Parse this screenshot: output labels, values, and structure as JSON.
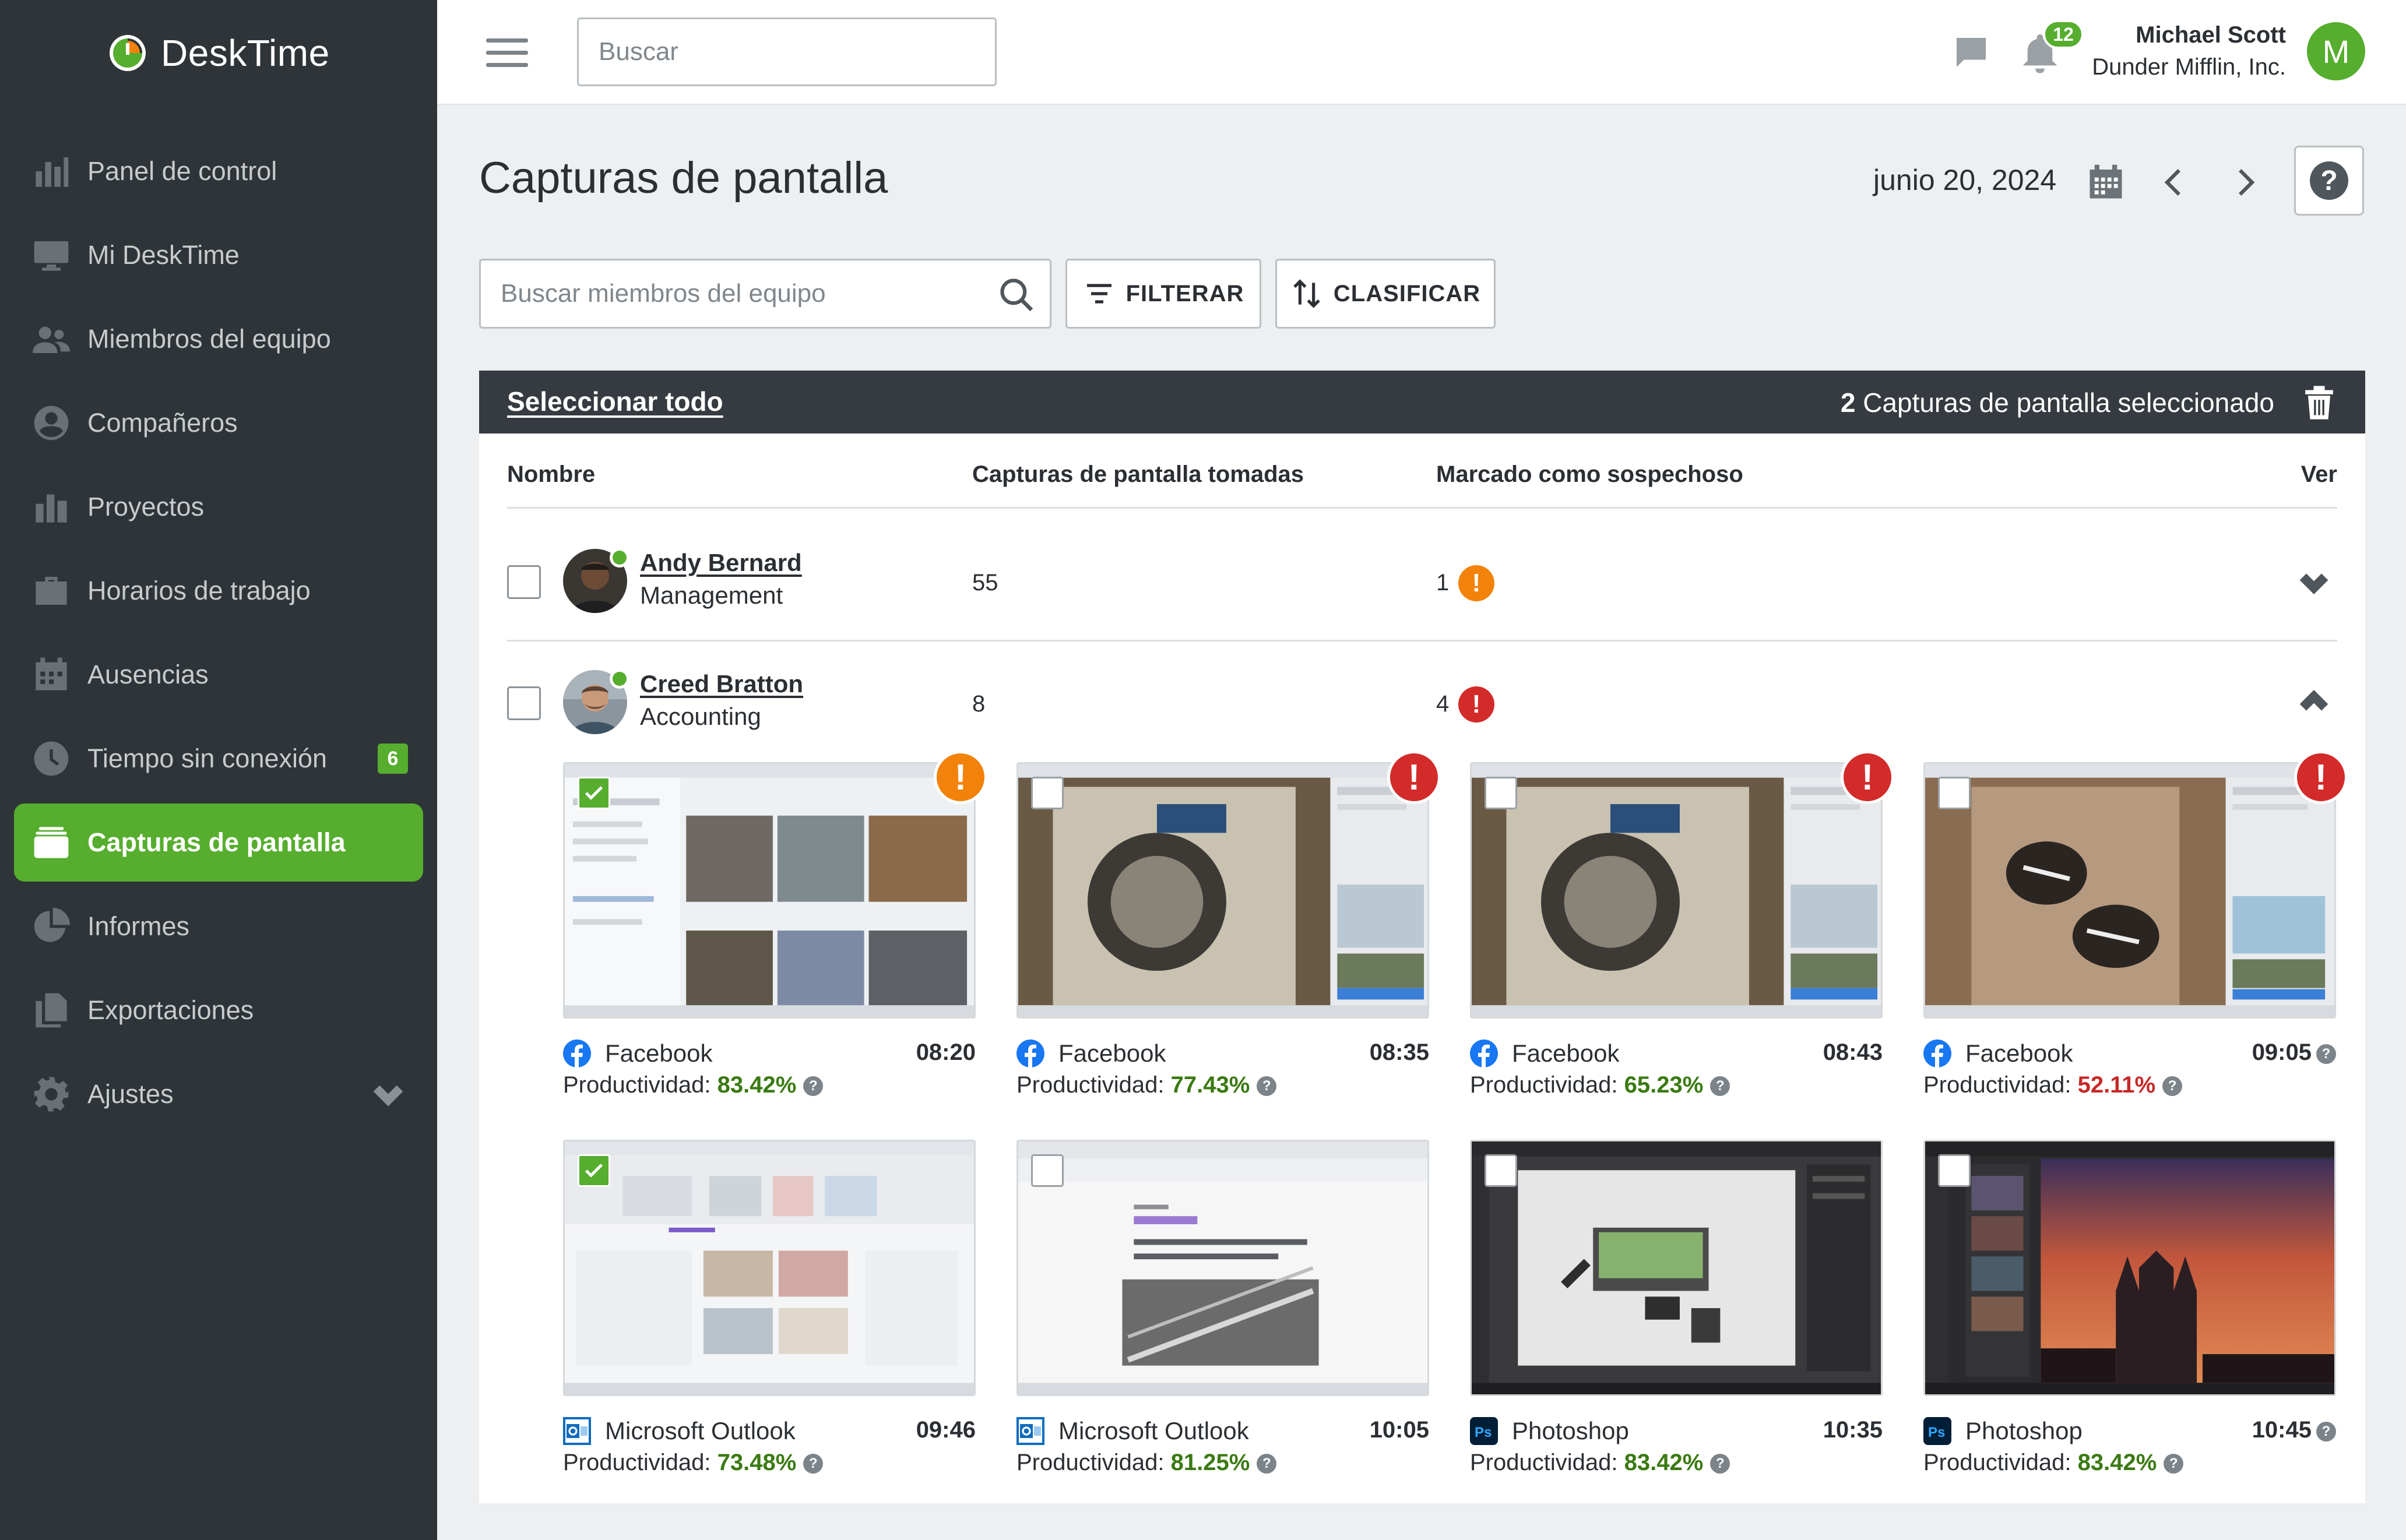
{
  "app": {
    "name": "DeskTime"
  },
  "sidebar": {
    "items": [
      {
        "label": "Panel de control",
        "icon": "bar-chart-icon"
      },
      {
        "label": "Mi DeskTime",
        "icon": "monitor-icon"
      },
      {
        "label": "Miembros del equipo",
        "icon": "team-icon"
      },
      {
        "label": "Compañeros",
        "icon": "user-circle-icon"
      },
      {
        "label": "Proyectos",
        "icon": "projects-chart-icon"
      },
      {
        "label": "Horarios de trabajo",
        "icon": "briefcase-icon"
      },
      {
        "label": "Ausencias",
        "icon": "calendar-icon"
      },
      {
        "label": "Tiempo sin conexión",
        "icon": "clock-icon",
        "badge": "6"
      },
      {
        "label": "Capturas de pantalla",
        "icon": "screenshots-icon",
        "active": true
      },
      {
        "label": "Informes",
        "icon": "pie-chart-icon"
      },
      {
        "label": "Exportaciones",
        "icon": "export-icon"
      },
      {
        "label": "Ajustes",
        "icon": "gear-icon",
        "expandable": true
      }
    ]
  },
  "topbar": {
    "search_placeholder": "Buscar",
    "notifications_count": "12",
    "user_name": "Michael Scott",
    "user_company": "Dunder Mifflin, Inc.",
    "user_initial": "M"
  },
  "page": {
    "title": "Capturas de pantalla",
    "date": "junio 20, 2024"
  },
  "toolbar": {
    "member_search_placeholder": "Buscar miembros del equipo",
    "filter_label": "FILTERAR",
    "sort_label": "CLASIFICAR"
  },
  "table": {
    "select_all": "Seleccionar todo",
    "selected_count": "2",
    "selected_text": "Capturas de pantalla seleccionado",
    "columns": {
      "name": "Nombre",
      "taken": "Capturas de pantalla tomadas",
      "suspicious": "Marcado como sospechoso",
      "view": "Ver"
    },
    "rows": [
      {
        "name": "Andy Bernard",
        "department": "Management",
        "taken": "55",
        "suspicious": "1",
        "flag_color": "#f2820a",
        "expanded": false
      },
      {
        "name": "Creed Bratton",
        "department": "Accounting",
        "taken": "8",
        "suspicious": "4",
        "flag_color": "#d32a2a",
        "expanded": true
      }
    ]
  },
  "screenshots": [
    {
      "app": "Facebook",
      "app_icon": "facebook-icon",
      "time": "08:20",
      "productivity_label": "Productividad:",
      "productivity": "83.42%",
      "checked": true,
      "flag": "orange"
    },
    {
      "app": "Facebook",
      "app_icon": "facebook-icon",
      "time": "08:35",
      "productivity_label": "Productividad:",
      "productivity": "77.43%",
      "checked": false,
      "flag": "red"
    },
    {
      "app": "Facebook",
      "app_icon": "facebook-icon",
      "time": "08:43",
      "productivity_label": "Productividad:",
      "productivity": "65.23%",
      "checked": false,
      "flag": "red"
    },
    {
      "app": "Facebook",
      "app_icon": "facebook-icon",
      "time": "09:05",
      "productivity_label": "Productividad:",
      "productivity": "52.11%",
      "checked": false,
      "flag": "red",
      "low": true
    },
    {
      "app": "Microsoft Outlook",
      "app_icon": "outlook-icon",
      "time": "09:46",
      "productivity_label": "Productividad:",
      "productivity": "73.48%",
      "checked": true
    },
    {
      "app": "Microsoft Outlook",
      "app_icon": "outlook-icon",
      "time": "10:05",
      "productivity_label": "Productividad:",
      "productivity": "81.25%",
      "checked": false
    },
    {
      "app": "Photoshop",
      "app_icon": "photoshop-icon",
      "time": "10:35",
      "productivity_label": "Productividad:",
      "productivity": "83.42%",
      "checked": false
    },
    {
      "app": "Photoshop",
      "app_icon": "photoshop-icon",
      "time": "10:45",
      "productivity_label": "Productividad:",
      "productivity": "83.42%",
      "checked": false
    }
  ],
  "colors": {
    "brand_green": "#56ad2e",
    "sidebar_bg": "#2e3438",
    "flag_orange": "#f2820a",
    "flag_red": "#d32a2a"
  }
}
